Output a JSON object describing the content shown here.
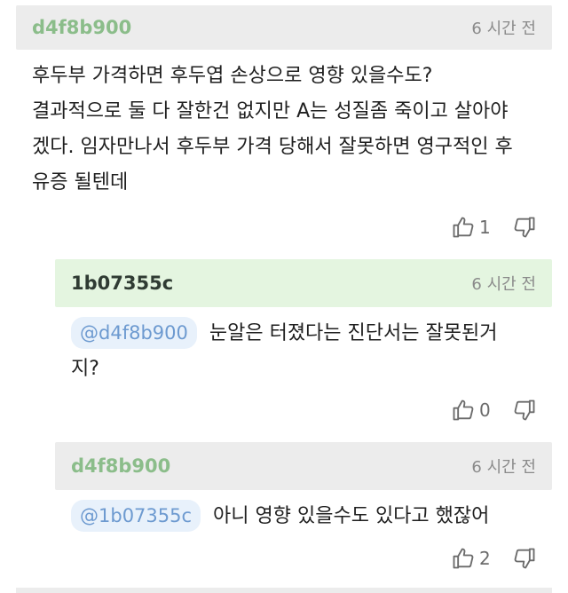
{
  "comments": [
    {
      "author": "d4f8b900",
      "time": "6 시간 전",
      "lines": [
        "후두부 가격하면 후두엽 손상으로 영향 있을수도?",
        "결과적으로 둘 다 잘한건 없지만 A는 성질좀 죽이고 살아야",
        "겠다. 임자만나서 후두부 가격 당해서 잘못하면 영구적인 후",
        "유증 될텐데"
      ],
      "likes": "1"
    },
    {
      "author": "1b07355c",
      "time": "6 시간 전",
      "mention": "@d4f8b900",
      "lines": [
        "눈알은 터졌다는 진단서는 잘못된거",
        "지?"
      ],
      "likes": "0"
    },
    {
      "author": "d4f8b900",
      "time": "6 시간 전",
      "mention": "@1b07355c",
      "lines": [
        "아니 영향 있을수도 있다고 했잖어"
      ],
      "likes": "2"
    }
  ],
  "icons": {
    "like": "thumbs-up-icon",
    "dislike": "thumbs-down-icon"
  }
}
